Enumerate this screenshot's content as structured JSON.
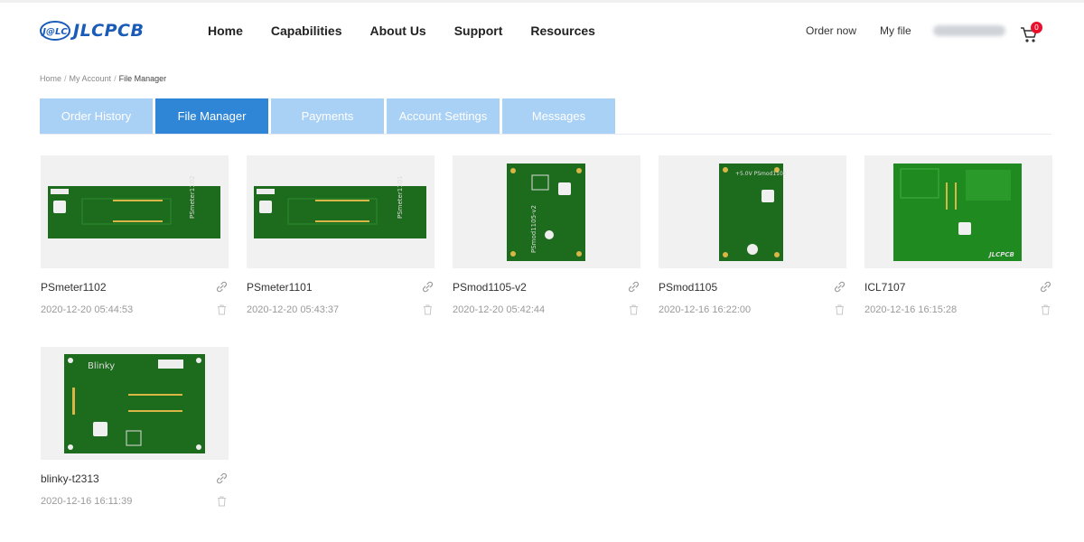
{
  "header": {
    "logo_mark": "J@LC",
    "logo_text": "JLCPCB",
    "nav": [
      "Home",
      "Capabilities",
      "About Us",
      "Support",
      "Resources"
    ],
    "order_now": "Order now",
    "my_file": "My file",
    "cart_count": "0"
  },
  "breadcrumb": {
    "items": [
      "Home",
      "My Account",
      "File Manager"
    ],
    "separator": "/"
  },
  "tabs": [
    {
      "label": "Order History",
      "active": false
    },
    {
      "label": "File Manager",
      "active": true
    },
    {
      "label": "Payments",
      "active": false
    },
    {
      "label": "Account Settings",
      "active": false
    },
    {
      "label": "Messages",
      "active": false
    }
  ],
  "files": [
    {
      "name": "PSmeter1102",
      "date": "2020-12-20 05:44:53",
      "board_text": "PSmeter1102"
    },
    {
      "name": "PSmeter1101",
      "date": "2020-12-20 05:43:37",
      "board_text": "PSmeter1101"
    },
    {
      "name": "PSmod1105-v2",
      "date": "2020-12-20 05:42:44",
      "board_text": "PSmod1105-v2"
    },
    {
      "name": "PSmod1105",
      "date": "2020-12-16 16:22:00",
      "board_text": "+5.0V PSmod1105"
    },
    {
      "name": "ICL7107",
      "date": "2020-12-16 16:15:28",
      "board_text": "JLCPCB"
    },
    {
      "name": "blinky-t2313",
      "date": "2020-12-16 16:11:39",
      "board_text": "Blinky"
    }
  ],
  "colors": {
    "brand": "#1a5bb8",
    "tab_active": "#2f86d6",
    "tab_inactive": "#a9d0f5",
    "pcb_green": "#1d6b1d",
    "badge": "#e8112d"
  },
  "icons": [
    "link-icon",
    "trash-icon",
    "cart-icon"
  ]
}
